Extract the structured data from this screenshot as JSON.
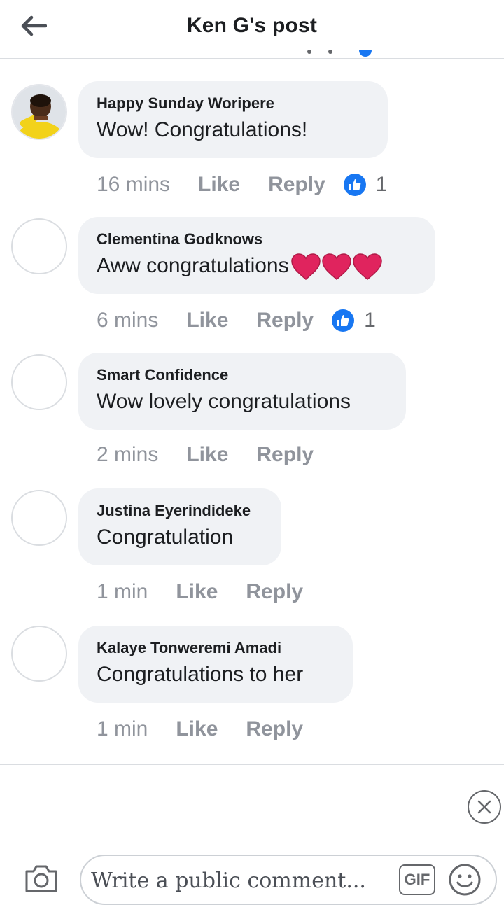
{
  "header": {
    "title": "Ken G's post"
  },
  "comments": [
    {
      "author": "Happy Sunday Woripere",
      "text": "Wow! Congratulations!",
      "time": "16 mins",
      "like_label": "Like",
      "reply_label": "Reply",
      "reaction_count": "1",
      "has_photo": true
    },
    {
      "author": "Clementina Godknows",
      "text": "Aww congratulations",
      "hearts": 3,
      "time": "6 mins",
      "like_label": "Like",
      "reply_label": "Reply",
      "reaction_count": "1"
    },
    {
      "author": "Smart Confidence",
      "text": "Wow lovely congratulations",
      "time": "2 mins",
      "like_label": "Like",
      "reply_label": "Reply"
    },
    {
      "author": "Justina Eyerindideke",
      "text": "Congratulation",
      "time": "1 min",
      "like_label": "Like",
      "reply_label": "Reply"
    },
    {
      "author": "Kalaye Tonweremi Amadi",
      "text": "Congratulations to her",
      "time": "1 min",
      "like_label": "Like",
      "reply_label": "Reply"
    }
  ],
  "composer": {
    "placeholder": "Write a public comment...",
    "gif_label": "GIF"
  },
  "icons": {
    "back": "arrow-left-icon",
    "like_reaction": "thumbs-up-icon",
    "heart": "red-heart-icon",
    "camera": "camera-icon",
    "emoji": "smiley-icon",
    "close": "close-circle-icon"
  },
  "colors": {
    "accent": "#1877f2",
    "bubble": "#f0f2f5",
    "meta_text": "#90949c",
    "heart": "#e0245e"
  }
}
